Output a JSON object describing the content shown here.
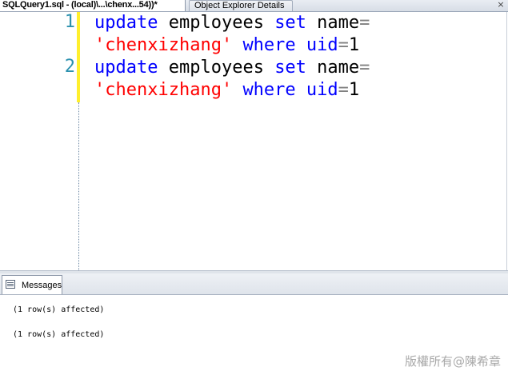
{
  "tabs": [
    {
      "label": "SQLQuery1.sql - (local)\\...\\chenx...54))*",
      "active": true
    },
    {
      "label": "Object Explorer Details",
      "active": false
    }
  ],
  "tab_close_glyph": "×",
  "editor": {
    "lines": [
      {
        "number": "1",
        "wrapped": [
          [
            {
              "t": "update",
              "k": "kw"
            },
            {
              "t": " employees ",
              "k": "plain"
            },
            {
              "t": "set",
              "k": "kw"
            },
            {
              "t": " name",
              "k": "plain"
            },
            {
              "t": "=",
              "k": "op"
            }
          ],
          [
            {
              "t": "'chenxizhang'",
              "k": "str"
            },
            {
              "t": " ",
              "k": "plain"
            },
            {
              "t": "where",
              "k": "kw"
            },
            {
              "t": " ",
              "k": "plain"
            },
            {
              "t": "uid",
              "k": "kw"
            },
            {
              "t": "=",
              "k": "op"
            },
            {
              "t": "1",
              "k": "plain"
            }
          ]
        ]
      },
      {
        "number": "2",
        "wrapped": [
          [
            {
              "t": "update",
              "k": "kw"
            },
            {
              "t": " employees ",
              "k": "plain"
            },
            {
              "t": "set",
              "k": "kw"
            },
            {
              "t": " name",
              "k": "plain"
            },
            {
              "t": "=",
              "k": "op"
            }
          ],
          [
            {
              "t": "'chenxizhang'",
              "k": "str"
            },
            {
              "t": " ",
              "k": "plain"
            },
            {
              "t": "where",
              "k": "kw"
            },
            {
              "t": " ",
              "k": "plain"
            },
            {
              "t": "uid",
              "k": "kw"
            },
            {
              "t": "=",
              "k": "op"
            },
            {
              "t": "1",
              "k": "plain"
            }
          ]
        ]
      }
    ]
  },
  "results_tab": {
    "label": "Messages",
    "icon": "messages-icon"
  },
  "messages": [
    "(1 row(s) affected)",
    "(1 row(s) affected)"
  ],
  "watermark": "版權所有@陳希章",
  "colors": {
    "keyword": "#0000ff",
    "string": "#ff0000",
    "operator": "#808080",
    "line_number": "#2b91af",
    "change_bar": "#ffef2c"
  }
}
